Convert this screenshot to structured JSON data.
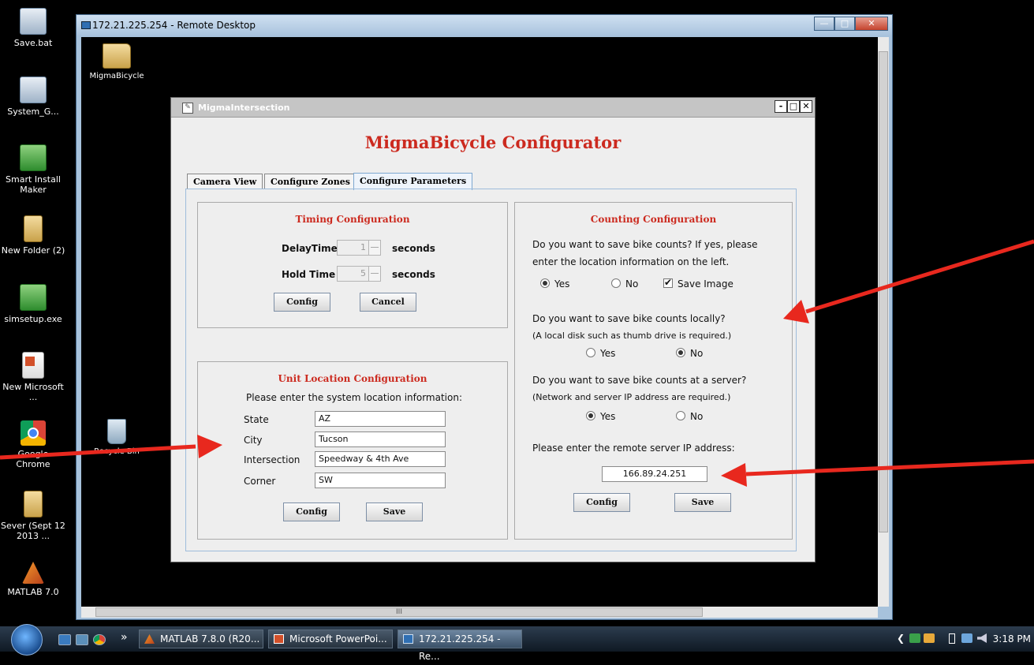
{
  "desktop": {
    "icons": [
      {
        "label": "Save.bat",
        "icon": "gear-icon"
      },
      {
        "label": "System_G...",
        "icon": "gear-icon"
      },
      {
        "label": "Smart Install Maker",
        "icon": "installer-icon"
      },
      {
        "label": "New Folder (2)",
        "icon": "folder-icon"
      },
      {
        "label": "simsetup.exe",
        "icon": "installer-icon"
      },
      {
        "label": "New Microsoft ...",
        "icon": "powerpoint-icon"
      },
      {
        "label": "Google Chrome",
        "icon": "chrome-icon"
      },
      {
        "label": "Sever (Sept 12 2013 ...",
        "icon": "folder-icon"
      },
      {
        "label": "MATLAB 7.0",
        "icon": "matlab-icon"
      }
    ]
  },
  "remote_desktop": {
    "title": "172.21.225.254 - Remote Desktop",
    "icons": [
      {
        "label": "MigmaBicycle",
        "icon": "folder-icon"
      },
      {
        "label": "Recycle Bin",
        "icon": "recycle-bin-icon"
      }
    ],
    "hscroll_label": "III"
  },
  "app": {
    "title": "MigmaIntersection",
    "heading": "MigmaBicycle Configurator",
    "tabs": [
      {
        "label": "Camera View",
        "active": false
      },
      {
        "label": "Configure Zones",
        "active": false
      },
      {
        "label": "Configure Parameters",
        "active": true
      }
    ],
    "timing": {
      "title": "Timing Configuration",
      "delay_label": "DelayTime",
      "delay_value": "1",
      "hold_label": "Hold Time",
      "hold_value": "5",
      "unit": "seconds",
      "config_button": "Config",
      "cancel_button": "Cancel"
    },
    "location": {
      "title": "Unit Location Configuration",
      "prompt": "Please enter the system location information:",
      "fields": [
        {
          "label": "State",
          "value": "AZ"
        },
        {
          "label": "City",
          "value": "Tucson"
        },
        {
          "label": "Intersection",
          "value": "Speedway & 4th Ave"
        },
        {
          "label": "Corner",
          "value": "SW"
        }
      ],
      "config_button": "Config",
      "save_button": "Save"
    },
    "counting": {
      "title": "Counting Configuration",
      "q1_line1": "Do you want to save bike counts? If yes, please",
      "q1_line2": "enter the location information on the left.",
      "q1_yes": "Yes",
      "q1_no": "No",
      "q1_selected": "Yes",
      "save_image": "Save Image",
      "save_image_checked": true,
      "q2": "Do you want to save bike counts locally?",
      "q2_note": "(A local disk such as thumb drive is required.)",
      "q2_yes": "Yes",
      "q2_no": "No",
      "q2_selected": "No",
      "q3": "Do you want to save bike counts at a server?",
      "q3_note": "(Network and server IP address are required.)",
      "q3_yes": "Yes",
      "q3_no": "No",
      "q3_selected": "Yes",
      "ip_prompt": "Please enter the remote server IP address:",
      "ip_value": "166.89.24.251",
      "config_button": "Config",
      "save_button": "Save"
    }
  },
  "taskbar": {
    "items": [
      {
        "label": "MATLAB  7.8.0 (R20...",
        "active": false
      },
      {
        "label": "Microsoft PowerPoi...",
        "active": false
      },
      {
        "label": "172.21.225.254 - Re...",
        "active": true
      }
    ],
    "overflow": "»",
    "clock": "3:18 PM"
  },
  "colors": {
    "annotation_arrow": "#e8281e",
    "heading_red": "#cc2a1f"
  }
}
